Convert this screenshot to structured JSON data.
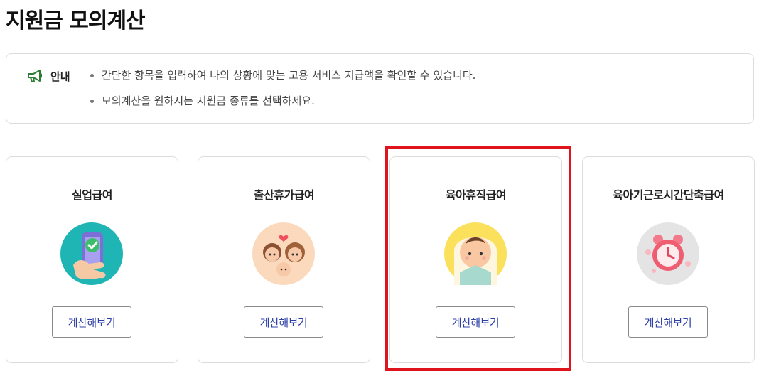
{
  "page": {
    "title": "지원금 모의계산"
  },
  "notice": {
    "icon": "megaphone-icon",
    "label": "안내",
    "items": [
      "간단한 항목을 입력하여 나의 상황에 맞는 고용 서비스 지급액을 확인할 수 있습니다.",
      "모의계산을 원하시는 지원금 종류를 선택하세요."
    ]
  },
  "cards": [
    {
      "title": "실업급여",
      "icon": "phone-check-icon",
      "button": "계산해보기"
    },
    {
      "title": "출산휴가급여",
      "icon": "family-icon",
      "button": "계산해보기"
    },
    {
      "title": "육아휴직급여",
      "icon": "baby-icon",
      "button": "계산해보기",
      "highlighted": true
    },
    {
      "title": "육아기근로시간단축급여",
      "icon": "alarm-clock-icon",
      "button": "계산해보기"
    }
  ],
  "colors": {
    "accent": "#2f3fa8",
    "highlight": "#e0141c",
    "notice_icon": "#2e7d32"
  }
}
